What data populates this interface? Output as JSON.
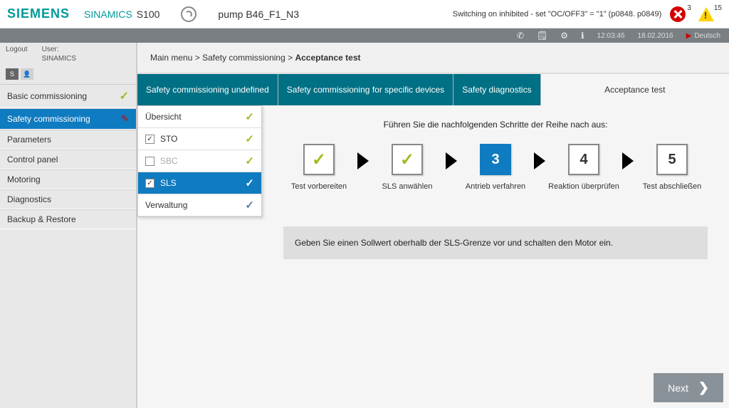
{
  "header": {
    "brand": "SIEMENS",
    "product_line": "SINAMICS",
    "device_series": "S100",
    "device_name": "pump B46_F1_N3",
    "status_message": "Switching on inhibited - set \"OC/OFF3\" = \"1\" (p0848. p0849)",
    "error_count": "3",
    "warning_count": "15"
  },
  "utilbar": {
    "time": "12:03:46",
    "date": "18.02.2016",
    "language": "Deutsch"
  },
  "sidebar": {
    "logout": "Logout",
    "user_label": "User:",
    "user_name": "SINAMICS",
    "items": [
      {
        "label": "Basic commissioning",
        "state": "done"
      },
      {
        "label": "Safety commissioning",
        "state": "active"
      },
      {
        "label": "Parameters",
        "state": ""
      },
      {
        "label": "Control panel",
        "state": ""
      },
      {
        "label": "Motoring",
        "state": ""
      },
      {
        "label": "Diagnostics",
        "state": ""
      },
      {
        "label": "Backup & Restore",
        "state": ""
      }
    ]
  },
  "breadcrumb": {
    "seg1": "Main menu",
    "seg2": "Safety commissioning",
    "seg3": "Acceptance test"
  },
  "tabs": {
    "t0": "Safety commissioning undefined",
    "t1": "Safety commissioning for specific devices",
    "t2": "Safety diagnostics",
    "t3": "Acceptance test"
  },
  "sublist": {
    "i0": "Übersicht",
    "i1": "STO",
    "i2": "SBC",
    "i3": "SLS",
    "i4": "Verwaltung"
  },
  "wizard": {
    "instruction": "Führen Sie die nachfolgenden Schritte der Reihe nach aus:",
    "steps": {
      "s1": "Test vorbereiten",
      "s2": "SLS anwählen",
      "s3": "Antrieb verfahren",
      "s4": "Reaktion überprüfen",
      "s5": "Test abschließen",
      "n3": "3",
      "n4": "4",
      "n5": "5"
    },
    "hint": "Geben Sie einen Sollwert oberhalb der SLS-Grenze vor und schalten den Motor ein."
  },
  "buttons": {
    "next": "Next"
  }
}
